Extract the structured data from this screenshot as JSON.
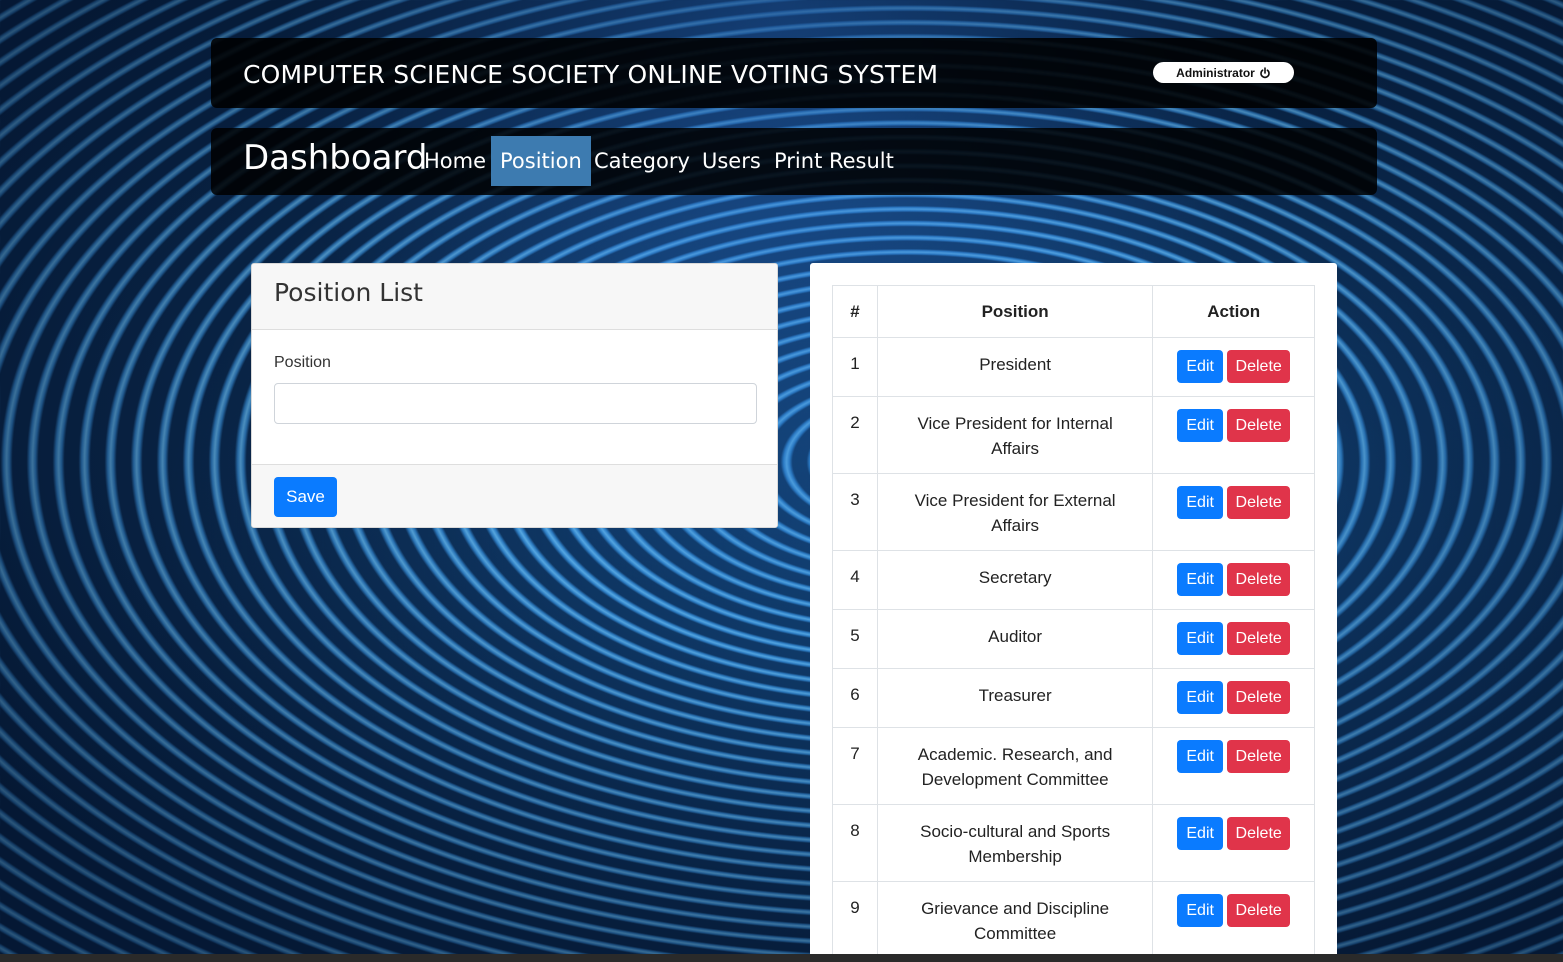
{
  "header": {
    "title": "COMPUTER SCIENCE SOCIETY ONLINE VOTING SYSTEM",
    "user_label": "Administrator",
    "user_icon": "power-icon"
  },
  "nav": {
    "brand": "Dashboard",
    "items": [
      {
        "label": "Home",
        "active": false
      },
      {
        "label": "Position",
        "active": true
      },
      {
        "label": "Category",
        "active": false
      },
      {
        "label": "Users",
        "active": false
      },
      {
        "label": "Print Result",
        "active": false
      }
    ]
  },
  "form": {
    "title": "Position List",
    "position_label": "Position",
    "position_value": "",
    "position_placeholder": "",
    "save_label": "Save"
  },
  "table": {
    "headers": [
      "#",
      "Position",
      "Action"
    ],
    "edit_label": "Edit",
    "delete_label": "Delete",
    "rows": [
      {
        "num": "1",
        "position": "President"
      },
      {
        "num": "2",
        "position": "Vice President for Internal Affairs"
      },
      {
        "num": "3",
        "position": "Vice President for External Affairs"
      },
      {
        "num": "4",
        "position": "Secretary"
      },
      {
        "num": "5",
        "position": "Auditor"
      },
      {
        "num": "6",
        "position": "Treasurer"
      },
      {
        "num": "7",
        "position": "Academic. Research, and Development Committee"
      },
      {
        "num": "8",
        "position": "Socio-cultural and Sports Membership"
      },
      {
        "num": "9",
        "position": "Grievance and Discipline Committee"
      }
    ]
  },
  "colors": {
    "primary": "#0a7bff",
    "danger": "#e0344a",
    "nav_active": "#3d7bb0"
  }
}
